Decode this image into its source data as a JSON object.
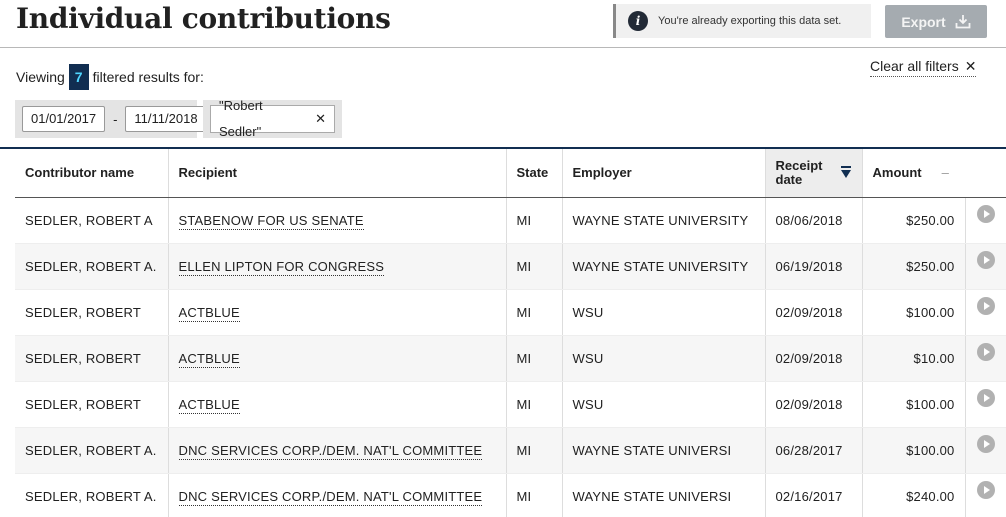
{
  "header": {
    "title": "Individual contributions",
    "notice": "You're already exporting this data set.",
    "export_label": "Export"
  },
  "filters": {
    "viewing_prefix": "Viewing",
    "count": "7",
    "viewing_suffix": "filtered results for:",
    "clear_all": "Clear all filters",
    "date_from": "01/01/2017",
    "date_separator": "-",
    "date_to": "11/11/2018",
    "name_query": "\"Robert Sedler\""
  },
  "table": {
    "columns": {
      "contributor": "Contributor name",
      "recipient": "Recipient",
      "state": "State",
      "employer": "Employer",
      "receipt_date": "Receipt date",
      "amount": "Amount"
    },
    "sort": {
      "column": "receipt_date",
      "direction": "descending"
    },
    "rows": [
      {
        "contributor": "SEDLER, ROBERT A",
        "recipient": "STABENOW FOR US SENATE",
        "state": "MI",
        "employer": "WAYNE STATE UNIVERSITY",
        "date": "08/06/2018",
        "amount": "$250.00"
      },
      {
        "contributor": "SEDLER, ROBERT A.",
        "recipient": "ELLEN LIPTON FOR CONGRESS",
        "state": "MI",
        "employer": "WAYNE STATE UNIVERSITY",
        "date": "06/19/2018",
        "amount": "$250.00"
      },
      {
        "contributor": "SEDLER, ROBERT",
        "recipient": "ACTBLUE",
        "state": "MI",
        "employer": "WSU",
        "date": "02/09/2018",
        "amount": "$100.00"
      },
      {
        "contributor": "SEDLER, ROBERT",
        "recipient": "ACTBLUE",
        "state": "MI",
        "employer": "WSU",
        "date": "02/09/2018",
        "amount": "$10.00"
      },
      {
        "contributor": "SEDLER, ROBERT",
        "recipient": "ACTBLUE",
        "state": "MI",
        "employer": "WSU",
        "date": "02/09/2018",
        "amount": "$100.00"
      },
      {
        "contributor": "SEDLER, ROBERT A.",
        "recipient": "DNC SERVICES CORP./DEM. NAT'L COMMITTEE",
        "state": "MI",
        "employer": "WAYNE STATE UNIVERSI",
        "date": "06/28/2017",
        "amount": "$100.00"
      },
      {
        "contributor": "SEDLER, ROBERT A.",
        "recipient": "DNC SERVICES CORP./DEM. NAT'L COMMITTEE",
        "state": "MI",
        "employer": "WAYNE STATE UNIVERSI",
        "date": "02/16/2017",
        "amount": "$240.00"
      }
    ]
  },
  "colors": {
    "navy": "#112e51",
    "badge_text": "#4fd6ff",
    "export_disabled": "#a5abb0"
  },
  "icons": {
    "notice": "info-icon",
    "export": "download-icon",
    "clear": "close-icon",
    "sort": "sort-descending-icon",
    "row_action": "play-icon"
  }
}
